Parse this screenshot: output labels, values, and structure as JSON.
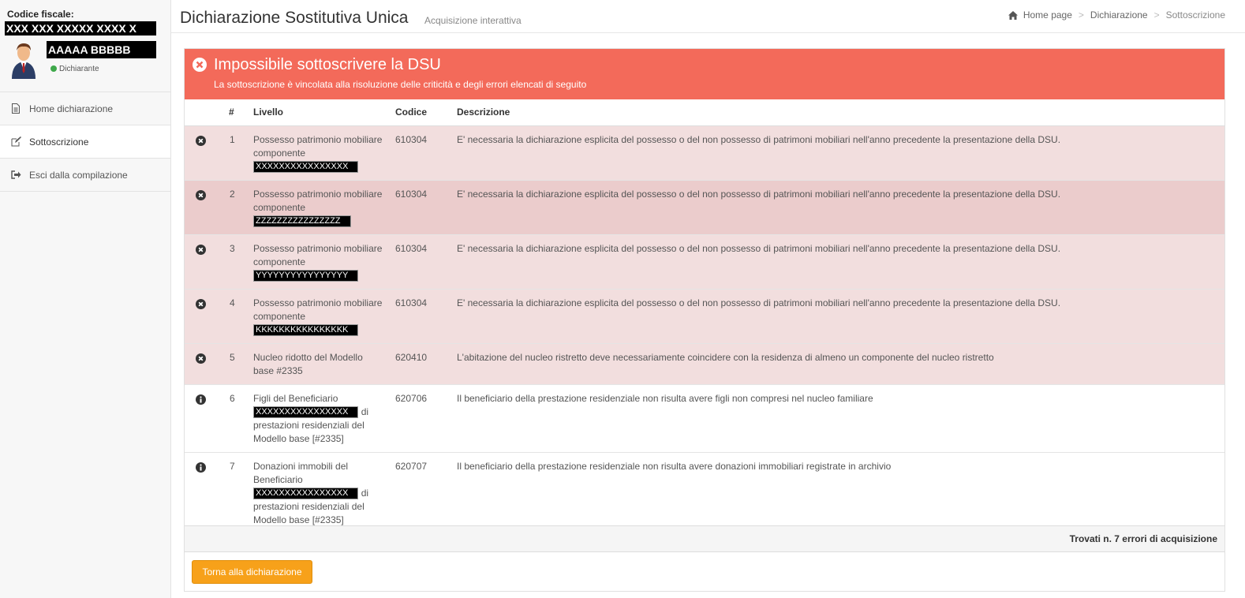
{
  "sidebar": {
    "fiscal_code_label": "Codice fiscale:",
    "fiscal_code_value": "XXX XXX XXXXX XXXX X",
    "user_name": "AAAAA BBBBB",
    "role": "Dichiarante",
    "items": [
      {
        "label": "Home dichiarazione",
        "icon": "file-icon",
        "active": false
      },
      {
        "label": "Sottoscrizione",
        "icon": "edit-icon",
        "active": true
      },
      {
        "label": "Esci dalla compilazione",
        "icon": "sign-out-icon",
        "active": false
      }
    ]
  },
  "header": {
    "title": "Dichiarazione Sostitutiva Unica",
    "subtitle": "Acquisizione interattiva",
    "breadcrumb": [
      "Home page",
      "Dichiarazione",
      "Sottoscrizione"
    ]
  },
  "alert": {
    "title": "Impossibile sottoscrivere la DSU",
    "text": "La sottoscrizione è vincolata alla risoluzione delle criticità e degli errori elencati di seguito",
    "color": "#f36a5a"
  },
  "table": {
    "headers": [
      "#",
      "Livello",
      "Codice",
      "Descrizione"
    ],
    "rows": [
      {
        "type": "error",
        "num": "1",
        "level_pre": "Possesso patrimonio mobiliare componente",
        "redacted": "XXXXXXXXXXXXXXXX",
        "level_post": "",
        "code": "610304",
        "description": "E' necessaria la dichiarazione esplicita del possesso o del non possesso di patrimoni mobiliari nell'anno precedente la presentazione della DSU."
      },
      {
        "type": "error",
        "num": "2",
        "level_pre": "Possesso patrimonio mobiliare componente",
        "redacted": "ZZZZZZZZZZZZZZZZ",
        "level_post": "",
        "code": "610304",
        "description": "E' necessaria la dichiarazione esplicita del possesso o del non possesso di patrimoni mobiliari nell'anno precedente la presentazione della DSU."
      },
      {
        "type": "error",
        "num": "3",
        "level_pre": "Possesso patrimonio mobiliare componente",
        "redacted": "YYYYYYYYYYYYYYYY",
        "level_post": "",
        "code": "610304",
        "description": "E' necessaria la dichiarazione esplicita del possesso o del non possesso di patrimoni mobiliari nell'anno precedente la presentazione della DSU."
      },
      {
        "type": "error",
        "num": "4",
        "level_pre": "Possesso patrimonio mobiliare componente",
        "redacted": "KKKKKKKKKKKKKKKK",
        "level_post": "",
        "code": "610304",
        "description": "E' necessaria la dichiarazione esplicita del possesso o del non possesso di patrimoni mobiliari nell'anno precedente la presentazione della DSU."
      },
      {
        "type": "error",
        "num": "5",
        "level_pre": "Nucleo ridotto del Modello base #2335",
        "redacted": "",
        "level_post": "",
        "code": "620410",
        "description": "L'abitazione del nucleo ristretto deve necessariamente coincidere con la residenza di almeno un componente del nucleo ristretto"
      },
      {
        "type": "info",
        "num": "6",
        "level_pre": "Figli del Beneficiario",
        "redacted": "XXXXXXXXXXXXXXXX",
        "level_post": "di prestazioni residenziali del Modello base [#2335]",
        "code": "620706",
        "description": "Il beneficiario della prestazione residenziale non risulta avere figli non compresi nel nucleo familiare"
      },
      {
        "type": "info",
        "num": "7",
        "level_pre": "Donazioni immobili del Beneficiario",
        "redacted": "XXXXXXXXXXXXXXXX",
        "level_post": "di prestazioni residenziali del Modello base [#2335]",
        "code": "620707",
        "description": "Il beneficiario della prestazione residenziale non risulta avere donazioni immobiliari registrate in archivio"
      }
    ]
  },
  "footer": {
    "summary": "Trovati n. 7 errori di acquisizione",
    "back_button": "Torna alla dichiarazione",
    "button_color": "#f7a11a"
  }
}
